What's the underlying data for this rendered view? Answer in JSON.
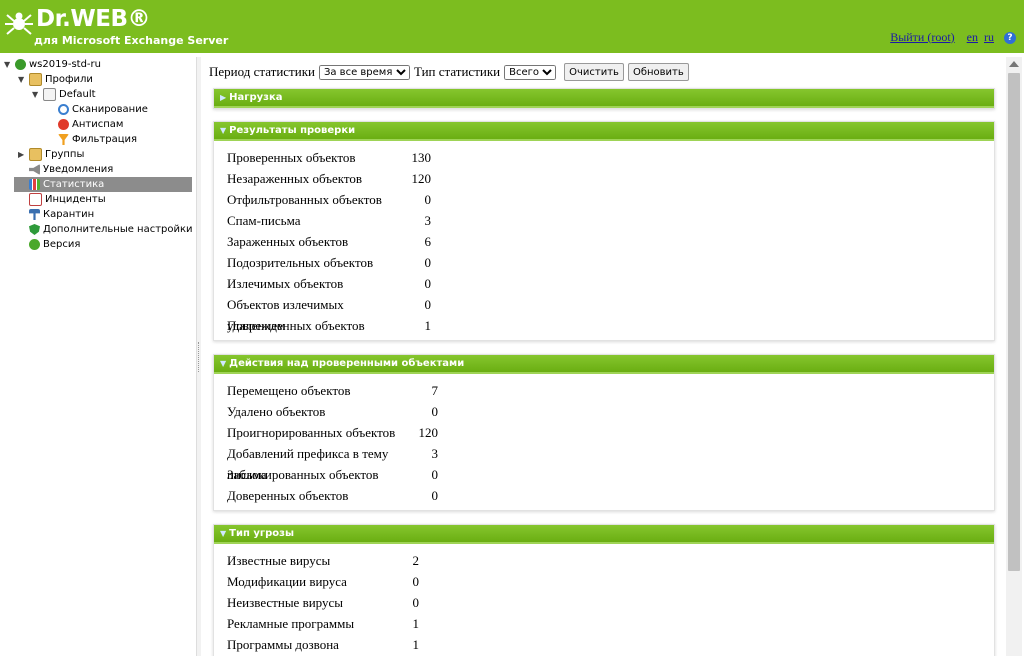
{
  "header": {
    "brand": "Dr.WEB®",
    "subtitle": "для Microsoft Exchange Server",
    "logout": "Выйти (root)",
    "lang_en": "en",
    "lang_ru": "ru",
    "help": "?"
  },
  "tree": {
    "server": "ws2019-std-ru",
    "profiles": "Профили",
    "default": "Default",
    "scan": "Сканирование",
    "antispam": "Антиспам",
    "filter": "Фильтрация",
    "groups": "Группы",
    "notifications": "Уведомления",
    "statistics": "Статистика",
    "incidents": "Инциденты",
    "quarantine": "Карантин",
    "advanced": "Дополнительные настройки",
    "version": "Версия"
  },
  "toolbar": {
    "period_label": "Период статистики",
    "period_value": "За все время",
    "type_label": "Тип статистики",
    "type_value": "Всего",
    "clear": "Очистить",
    "refresh": "Обновить"
  },
  "panels": {
    "load": {
      "title": "Нагрузка"
    },
    "results": {
      "title": "Результаты проверки",
      "rows": [
        {
          "label": "Проверенных объектов",
          "value": "130"
        },
        {
          "label": "Незараженных объектов",
          "value": "120"
        },
        {
          "label": "Отфильтрованных объектов",
          "value": "0"
        },
        {
          "label": "Спам-письма",
          "value": "3"
        },
        {
          "label": "Зараженных объектов",
          "value": "6"
        },
        {
          "label": "Подозрительных объектов",
          "value": "0"
        },
        {
          "label": "Излечимых объектов",
          "value": "0"
        },
        {
          "label": "Объектов излечимых удалением",
          "value": "0"
        },
        {
          "label": "Поврежденных объектов",
          "value": "1"
        }
      ]
    },
    "actions": {
      "title": "Действия над проверенными объектами",
      "rows": [
        {
          "label": "Перемещено объектов",
          "value": "7"
        },
        {
          "label": "Удалено объектов",
          "value": "0"
        },
        {
          "label": "Проигнорированных объектов",
          "value": "120"
        },
        {
          "label": "Добавлений префикса в тему письма",
          "value": "3"
        },
        {
          "label": "Заблокированных объектов",
          "value": "0"
        },
        {
          "label": "Доверенных объектов",
          "value": "0"
        }
      ]
    },
    "threats": {
      "title": "Тип угрозы",
      "rows": [
        {
          "label": "Известные вирусы",
          "value": "2"
        },
        {
          "label": "Модификации вируса",
          "value": "0"
        },
        {
          "label": "Неизвестные вирусы",
          "value": "0"
        },
        {
          "label": "Рекламные программы",
          "value": "1"
        },
        {
          "label": "Программы дозвона",
          "value": "1"
        }
      ]
    }
  },
  "colors": {
    "header_bg": "#7cbd1f",
    "panel_head": "#6aae12",
    "selected": "#8c8c8c",
    "link": "#1a1aa6"
  }
}
